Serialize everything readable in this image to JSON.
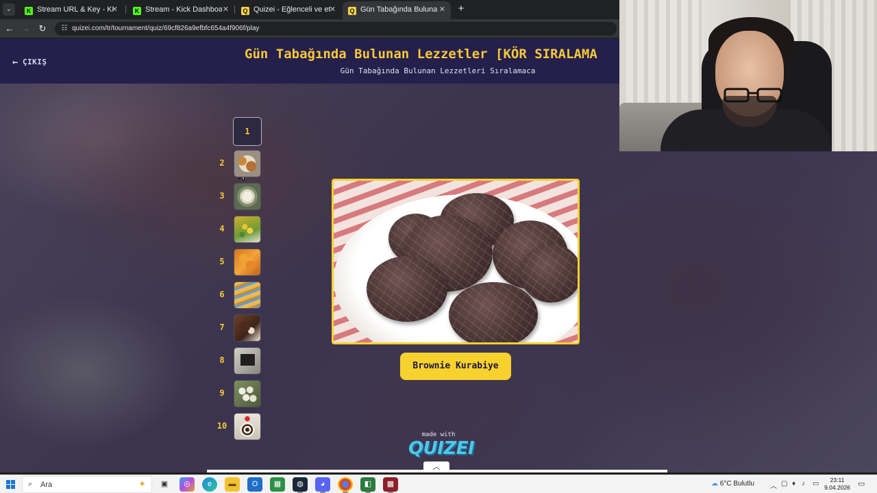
{
  "browser": {
    "tabs": [
      {
        "label": "Stream URL & Key - Kick Dashb",
        "favicon": "kick-icon",
        "active": false
      },
      {
        "label": "Stream - Kick Dashboard",
        "favicon": "kick-icon",
        "active": false
      },
      {
        "label": "Quizei - Eğlenceli ve etkileşimli",
        "favicon": "quizei-icon",
        "active": false
      },
      {
        "label": "Gün Tabağında Bulunan Lezzetl",
        "favicon": "quizei-icon",
        "active": true
      }
    ],
    "url": "quizei.com/tr/tournament/quiz/69cf826a9efbfc654a4f906f/play"
  },
  "header": {
    "exit_label": "ÇIKIŞ",
    "title": "Gün Tabağında Bulunan Lezzetler [KÖR SIRALAMA",
    "subtitle": "Gün Tabağında Bulunan Lezzetleri Sıralamaca"
  },
  "ranking": {
    "slots": [
      {
        "rank": "1",
        "state": "empty"
      },
      {
        "rank": "2",
        "state": "filled"
      },
      {
        "rank": "3",
        "state": "filled"
      },
      {
        "rank": "4",
        "state": "filled"
      },
      {
        "rank": "5",
        "state": "filled"
      },
      {
        "rank": "6",
        "state": "filled"
      },
      {
        "rank": "7",
        "state": "filled"
      },
      {
        "rank": "8",
        "state": "filled"
      },
      {
        "rank": "9",
        "state": "filled"
      },
      {
        "rank": "10",
        "state": "filled"
      }
    ]
  },
  "current_item": {
    "name": "Brownie Kurabiye"
  },
  "footer": {
    "made_with": "made with",
    "brand": "QUIZEI"
  },
  "taskbar": {
    "search_placeholder": "Ara",
    "weather": "6°C Bulutlu",
    "time": "23:11",
    "date": "9.04.2026"
  },
  "colors": {
    "accent_yellow": "#f7d12e",
    "header_bg": "#241f4b",
    "title_yellow": "#f7c938"
  }
}
